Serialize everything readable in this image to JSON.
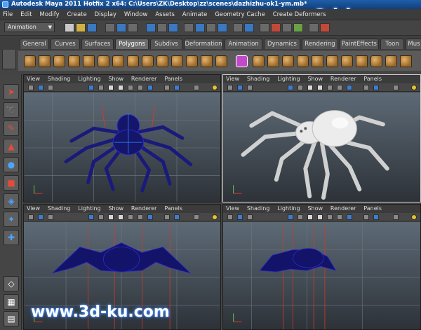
{
  "window": {
    "title": "Autodesk Maya 2011 Hotfix 2 x64: C:\\Users\\ZK\\Desktop\\zz\\scenes\\dazhizhu-ok1-ym.mb*",
    "watermark": "www.3d-ku.com"
  },
  "menubar": {
    "items": [
      "File",
      "Edit",
      "Modify",
      "Create",
      "Display",
      "Window",
      "Assets",
      "Animate",
      "Geometry Cache",
      "Create Deformers"
    ]
  },
  "statusline": {
    "mode": "Animation"
  },
  "shelf": {
    "tabs": [
      "General",
      "Curves",
      "Surfaces",
      "Polygons",
      "Subdivs",
      "Deformation",
      "Animation",
      "Dynamics",
      "Rendering",
      "PaintEffects",
      "Toon",
      "Mus"
    ],
    "active_tab": "Polygons"
  },
  "viewport_menu": [
    "View",
    "Shading",
    "Lighting",
    "Show",
    "Renderer",
    "Panels"
  ],
  "viewports": [
    {
      "name": "top-left",
      "shading": "wireframe"
    },
    {
      "name": "top-right",
      "shading": "smooth"
    },
    {
      "name": "bottom-left",
      "shading": "wireframe"
    },
    {
      "name": "bottom-right",
      "shading": "wireframe"
    }
  ],
  "colors": {
    "wire": "#1a1a7a",
    "wire_bright": "#2c2ccc",
    "selection": "#2c86ff",
    "gizmo_red": "#d23a2a",
    "mesh_white": "#e8e8e8"
  }
}
